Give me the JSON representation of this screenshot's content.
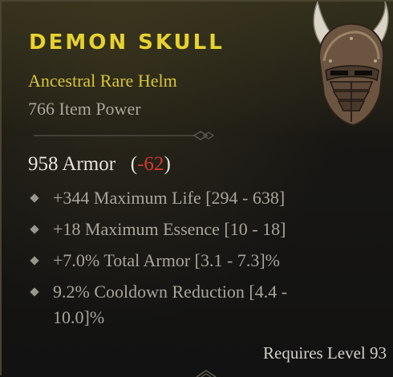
{
  "item": {
    "name": "DEMON SKULL",
    "type_line": "Ancestral Rare Helm",
    "item_power": "766 Item Power",
    "armor_label": "958 Armor",
    "armor_delta": "-62",
    "affixes": [
      "+344 Maximum Life [294 - 638]",
      "+18 Maximum Essence [10 - 18]",
      "+7.0% Total Armor [3.1 - 7.3]%",
      "9.2% Cooldown Reduction [4.4 -",
      "10.0]%"
    ],
    "requires": "Requires Level 93"
  },
  "colors": {
    "rare_yellow": "#e6d22c",
    "stat_gray": "#a9a59b",
    "negative_red": "#d13a2e"
  },
  "icons": {
    "item_image": "horned-helm-icon",
    "bullet": "diamond-bullet-icon"
  }
}
